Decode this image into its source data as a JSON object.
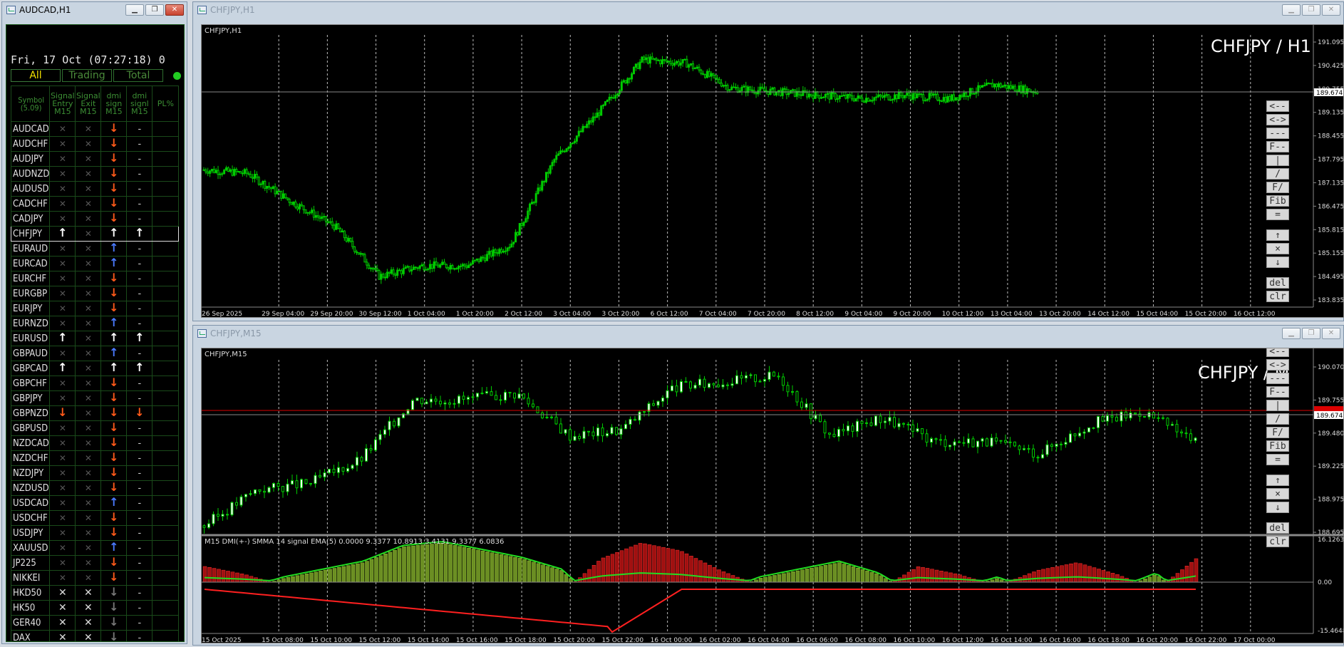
{
  "panel_window": {
    "title": "AUDCAD,H1"
  },
  "panel": {
    "clock": "Fri, 17 Oct (07:27:18) 0",
    "tabs": [
      "All",
      "Trading",
      "Total"
    ],
    "headers": [
      "Symbol (5.09)",
      "Signal Entry M15",
      "Signal Exit M15",
      "dmi sign M15",
      "dmi signl M15",
      "PL%"
    ],
    "rows": [
      {
        "symbol": "AUDCAD",
        "entry": "x",
        "exit": "x",
        "dmi": "down-red",
        "dmi2": "-"
      },
      {
        "symbol": "AUDCHF",
        "entry": "x",
        "exit": "x",
        "dmi": "down-red",
        "dmi2": "-"
      },
      {
        "symbol": "AUDJPY",
        "entry": "x",
        "exit": "x",
        "dmi": "down-red",
        "dmi2": "-"
      },
      {
        "symbol": "AUDNZD",
        "entry": "x",
        "exit": "x",
        "dmi": "down-red",
        "dmi2": "-"
      },
      {
        "symbol": "AUDUSD",
        "entry": "x",
        "exit": "x",
        "dmi": "down-red",
        "dmi2": "-"
      },
      {
        "symbol": "CADCHF",
        "entry": "x",
        "exit": "x",
        "dmi": "down-red",
        "dmi2": "-"
      },
      {
        "symbol": "CADJPY",
        "entry": "x",
        "exit": "x",
        "dmi": "down-red",
        "dmi2": "-"
      },
      {
        "symbol": "CHFJPY",
        "entry": "up-white",
        "exit": "x",
        "dmi": "up-white",
        "dmi2": "up-white",
        "selected": true
      },
      {
        "symbol": "EURAUD",
        "entry": "x",
        "exit": "x",
        "dmi": "up-blue",
        "dmi2": "-"
      },
      {
        "symbol": "EURCAD",
        "entry": "x",
        "exit": "x",
        "dmi": "up-blue",
        "dmi2": "-"
      },
      {
        "symbol": "EURCHF",
        "entry": "x",
        "exit": "x",
        "dmi": "down-red",
        "dmi2": "-"
      },
      {
        "symbol": "EURGBP",
        "entry": "x",
        "exit": "x",
        "dmi": "down-red",
        "dmi2": "-"
      },
      {
        "symbol": "EURJPY",
        "entry": "x",
        "exit": "x",
        "dmi": "down-red",
        "dmi2": "-"
      },
      {
        "symbol": "EURNZD",
        "entry": "x",
        "exit": "x",
        "dmi": "up-blue",
        "dmi2": "-"
      },
      {
        "symbol": "EURUSD",
        "entry": "up-white",
        "exit": "x",
        "dmi": "up-white",
        "dmi2": "up-white"
      },
      {
        "symbol": "GBPAUD",
        "entry": "x",
        "exit": "x",
        "dmi": "up-blue",
        "dmi2": "-"
      },
      {
        "symbol": "GBPCAD",
        "entry": "up-white",
        "exit": "x",
        "dmi": "up-white",
        "dmi2": "up-white"
      },
      {
        "symbol": "GBPCHF",
        "entry": "x",
        "exit": "x",
        "dmi": "down-red",
        "dmi2": "-"
      },
      {
        "symbol": "GBPJPY",
        "entry": "x",
        "exit": "x",
        "dmi": "down-red",
        "dmi2": "-"
      },
      {
        "symbol": "GBPNZD",
        "entry": "down-red",
        "exit": "x",
        "dmi": "down-red",
        "dmi2": "down-red"
      },
      {
        "symbol": "GBPUSD",
        "entry": "x",
        "exit": "x",
        "dmi": "down-red",
        "dmi2": "-"
      },
      {
        "symbol": "NZDCAD",
        "entry": "x",
        "exit": "x",
        "dmi": "down-red",
        "dmi2": "-"
      },
      {
        "symbol": "NZDCHF",
        "entry": "x",
        "exit": "x",
        "dmi": "down-red",
        "dmi2": "-"
      },
      {
        "symbol": "NZDJPY",
        "entry": "x",
        "exit": "x",
        "dmi": "down-red",
        "dmi2": "-"
      },
      {
        "symbol": "NZDUSD",
        "entry": "x",
        "exit": "x",
        "dmi": "down-red",
        "dmi2": "-"
      },
      {
        "symbol": "USDCAD",
        "entry": "x",
        "exit": "x",
        "dmi": "up-blue",
        "dmi2": "-"
      },
      {
        "symbol": "USDCHF",
        "entry": "x",
        "exit": "x",
        "dmi": "down-red",
        "dmi2": "-"
      },
      {
        "symbol": "USDJPY",
        "entry": "x",
        "exit": "x",
        "dmi": "down-red",
        "dmi2": "-"
      },
      {
        "symbol": "XAUUSD",
        "entry": "x",
        "exit": "x",
        "dmi": "up-blue",
        "dmi2": "-"
      },
      {
        "symbol": "JP225",
        "entry": "x",
        "exit": "x",
        "dmi": "down-red",
        "dmi2": "-"
      },
      {
        "symbol": "NIKKEI",
        "entry": "x",
        "exit": "x",
        "dmi": "down-red",
        "dmi2": "-"
      },
      {
        "symbol": "HKD50",
        "entry": "x-white",
        "exit": "x-white",
        "dmi": "down-gray",
        "dmi2": "-"
      },
      {
        "symbol": "HK50",
        "entry": "x-white",
        "exit": "x-white",
        "dmi": "down-gray",
        "dmi2": "-"
      },
      {
        "symbol": "GER40",
        "entry": "x-white",
        "exit": "x-white",
        "dmi": "down-gray",
        "dmi2": "-"
      },
      {
        "symbol": "DAX",
        "entry": "x-white",
        "exit": "x-white",
        "dmi": "down-gray",
        "dmi2": "-"
      }
    ]
  },
  "h1_window": {
    "title": "CHFJPY,H1",
    "chart_label": "CHFJPY,H1",
    "big_label": "CHFJPY / H1",
    "price_tag": "189.674",
    "y_ticks": [
      "191.095",
      "190.425",
      "189.755",
      "189.135",
      "188.455",
      "187.795",
      "187.135",
      "186.475",
      "185.815",
      "185.155",
      "184.495",
      "183.835"
    ],
    "x_ticks": [
      "26 Sep 2025",
      "29 Sep 04:00",
      "29 Sep 20:00",
      "30 Sep 12:00",
      "1 Oct 04:00",
      "1 Oct 20:00",
      "2 Oct 12:00",
      "3 Oct 04:00",
      "3 Oct 20:00",
      "6 Oct 12:00",
      "7 Oct 04:00",
      "7 Oct 20:00",
      "8 Oct 12:00",
      "9 Oct 04:00",
      "9 Oct 20:00",
      "10 Oct 12:00",
      "13 Oct 04:00",
      "13 Oct 20:00",
      "14 Oct 12:00",
      "15 Oct 04:00",
      "15 Oct 20:00",
      "16 Oct 12:00"
    ]
  },
  "m15_window": {
    "title": "CHFJPY,M15",
    "chart_label": "CHFJPY,M15",
    "big_label": "CHFJPY / M",
    "price_tag": "189.674",
    "y_ticks": [
      "190.070",
      "189.755",
      "189.480",
      "189.225",
      "188.975",
      "188.695"
    ],
    "indicator_label": "M15 DMI(+-)  SMMA 14  signal EMA(5)  0.0000 9.3377 10.8913 3.4131 9.3377 6.0836",
    "ind_ticks": [
      "16.1263",
      "0.00",
      "-15.4648"
    ],
    "x_ticks": [
      "15 Oct 2025",
      "15 Oct 08:00",
      "15 Oct 10:00",
      "15 Oct 12:00",
      "15 Oct 14:00",
      "15 Oct 16:00",
      "15 Oct 18:00",
      "15 Oct 20:00",
      "15 Oct 22:00",
      "16 Oct 00:00",
      "16 Oct 02:00",
      "16 Oct 04:00",
      "16 Oct 06:00",
      "16 Oct 08:00",
      "16 Oct 10:00",
      "16 Oct 12:00",
      "16 Oct 14:00",
      "16 Oct 16:00",
      "16 Oct 18:00",
      "16 Oct 20:00",
      "16 Oct 22:00",
      "17 Oct 00:00"
    ]
  },
  "side_buttons": [
    "<--",
    "<->",
    "---",
    "F--",
    "|",
    "/",
    "F/",
    "Fib",
    "=",
    "↑",
    "×",
    "↓",
    "del",
    "clr"
  ],
  "chart_data": [
    {
      "type": "line",
      "series": [
        {
          "values": [
            187.5,
            187.4,
            186.6,
            185.9,
            184.5,
            184.8,
            184.8,
            185.4,
            187.8,
            189.1,
            190.6,
            190.5,
            189.8,
            189.7,
            189.6,
            189.5,
            189.6,
            189.5,
            189.9,
            189.7
          ]
        }
      ],
      "ylim": [
        183.835,
        191.095
      ]
    },
    {
      "type": "line",
      "series": [
        {
          "values": [
            188.75,
            189.05,
            189.1,
            189.3,
            189.8,
            189.8,
            189.85,
            189.5,
            189.55,
            189.9,
            189.95,
            190.0,
            189.5,
            189.65,
            189.45,
            189.45,
            189.35,
            189.6,
            189.7,
            189.45
          ]
        }
      ],
      "ylim": [
        188.695,
        190.07
      ]
    }
  ],
  "colors": {
    "bull": "#00cc00",
    "up_arrow_blue": "#4a7aff",
    "down_arrow": "#ff5a1a",
    "dmi_plus": "#22dd22",
    "dmi_minus": "#ff2020"
  }
}
